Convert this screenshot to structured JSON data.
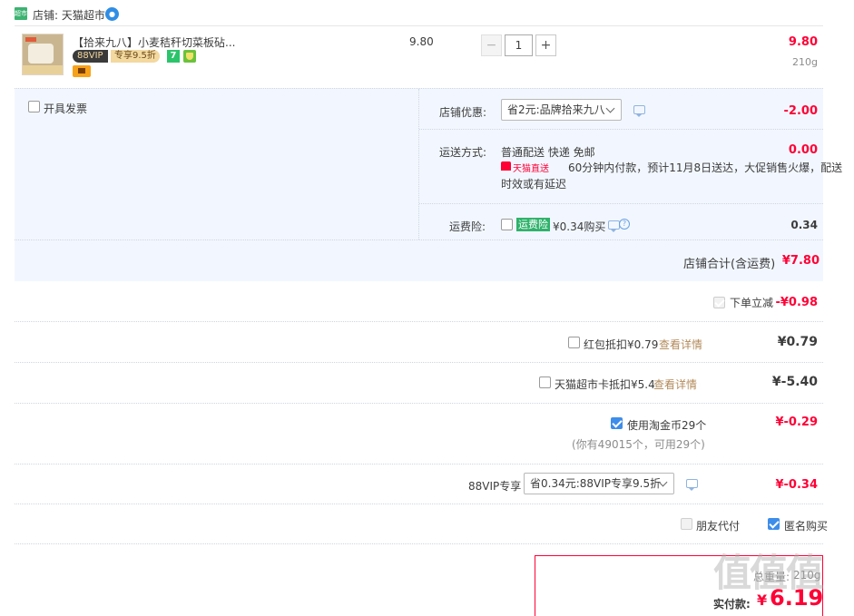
{
  "store": {
    "icon_text": "超市",
    "label": "店铺: 天猫超市",
    "badge_icon": "wangwang-icon"
  },
  "item": {
    "title": "【拾来九八】小麦秸秆切菜板砧...",
    "tag_vip": "88VIP",
    "tag_discount": "专享9.5折",
    "tag_seven": "7",
    "unit_price": "9.80",
    "quantity": "1",
    "minus": "−",
    "plus": "+",
    "subtotal": "9.80",
    "weight": "210g"
  },
  "invoice": {
    "label": "开具发票"
  },
  "coupon": {
    "label": "店铺优惠:",
    "value": "省2元:品牌拾来九八",
    "amount": "-2.00"
  },
  "delivery": {
    "label": "运送方式:",
    "method": "普通配送 快递 免邮",
    "amount": "0.00",
    "tmall_tag": "天猫直送",
    "note1": "60分钟内付款，预计11月8日送达，大促销售火爆，配送",
    "note2": "时效或有延迟"
  },
  "insurance": {
    "label": "运费险:",
    "tag": "运费险",
    "price": "¥0.34购买",
    "amount": "0.34"
  },
  "store_total": {
    "label": "店铺合计(含运费)",
    "amount": "¥7.80"
  },
  "instant_discount": {
    "label": "下单立减",
    "amount": "-¥0.98"
  },
  "red_packet": {
    "label": "红包抵扣¥0.79",
    "link": "查看详情",
    "amount": "¥0.79"
  },
  "market_card": {
    "label": "天猫超市卡抵扣¥5.4",
    "link": "查看详情",
    "amount": "¥-5.40"
  },
  "taojin": {
    "label": "使用淘金币29个",
    "sub": "(你有49015个，可用29个)",
    "amount": "¥-0.29"
  },
  "vip88": {
    "label": "88VIP专享",
    "value": "省0.34元:88VIP专享9.5折",
    "amount": "¥-0.34"
  },
  "friend_pay": {
    "label": "朋友代付"
  },
  "anonymous": {
    "label": "匿名购买"
  },
  "summary": {
    "weight_label": "总重量:",
    "weight": "210g",
    "pay_label": "实付款:",
    "pay_amount": "6.19",
    "watermark": "值值值"
  },
  "colors": {
    "accent_red": "#ff0036",
    "panel_bg": "#f2f7ff",
    "checkbox_blue": "#3d8dea",
    "link_brown": "#b38a5a"
  }
}
